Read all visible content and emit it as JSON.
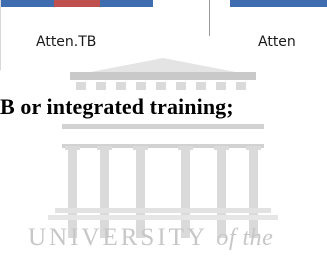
{
  "chart_fragment": {
    "category_labels": [
      "Atten.TB",
      "Atten"
    ]
  },
  "body_text": {
    "sentence": "B or integrated training;"
  },
  "watermark": {
    "main": "UNIVERSITY",
    "suffix": "of the"
  },
  "colors": {
    "series_blue": "#3f6db0",
    "series_red": "#c0504d",
    "watermark_gray": "#c7c7c7"
  }
}
